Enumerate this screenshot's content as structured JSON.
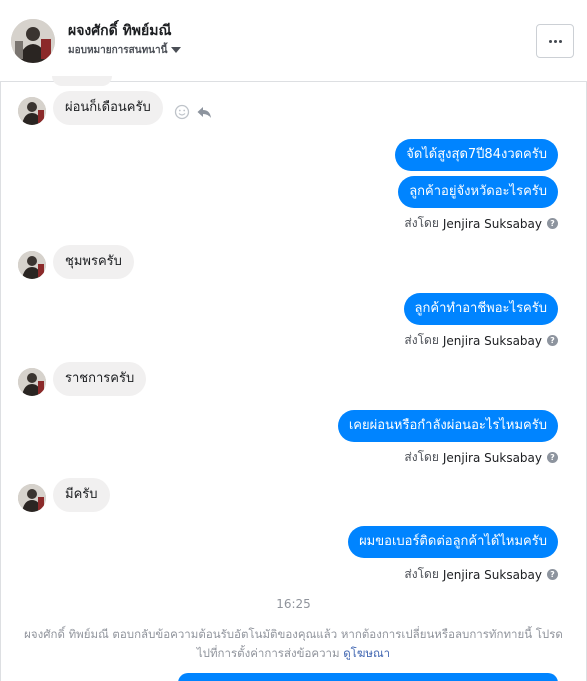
{
  "header": {
    "name": "ผจงศักดิ์ ทิพย์มณี",
    "subtitle": "มอบหมายการสนทนานี้"
  },
  "messages": {
    "in1": "ผ่อนก็เดือนครับ",
    "out1": "จัดได้สูงสุด7ปี84งวดครับ",
    "out2": "ลูกค้าอยู่จังหวัดอะไรครับ",
    "in2": "ชุมพรครับ",
    "out3": "ลูกค้าทำอาชีพอะไรครับ",
    "in3": "ราชการครับ",
    "out4": "เคยผ่อนหรือกำลังผ่อนอะไรไหมครับ",
    "in4": "มีครับ",
    "out5": "ผมขอเบอร์ติดต่อลูกค้าได้ไหมครับ"
  },
  "sent_by": {
    "label": "ส่งโดย",
    "name": "Jenjira Suksabay",
    "help": "?"
  },
  "timestamp": "16:25",
  "notice": {
    "text": "ผจงศักดิ์ ทิพย์มณี ตอบกลับข้อความต้อนรับอัตโนมัติของคุณแล้ว หากต้องการเปลี่ยนหรือลบการทักทายนี้ โปรดไปที่การตั้งค่าการส่งข้อความ",
    "link": "ดูโฆษณา"
  },
  "colors": {
    "outgoing": "#0084ff",
    "incoming": "#f1f0f0"
  }
}
